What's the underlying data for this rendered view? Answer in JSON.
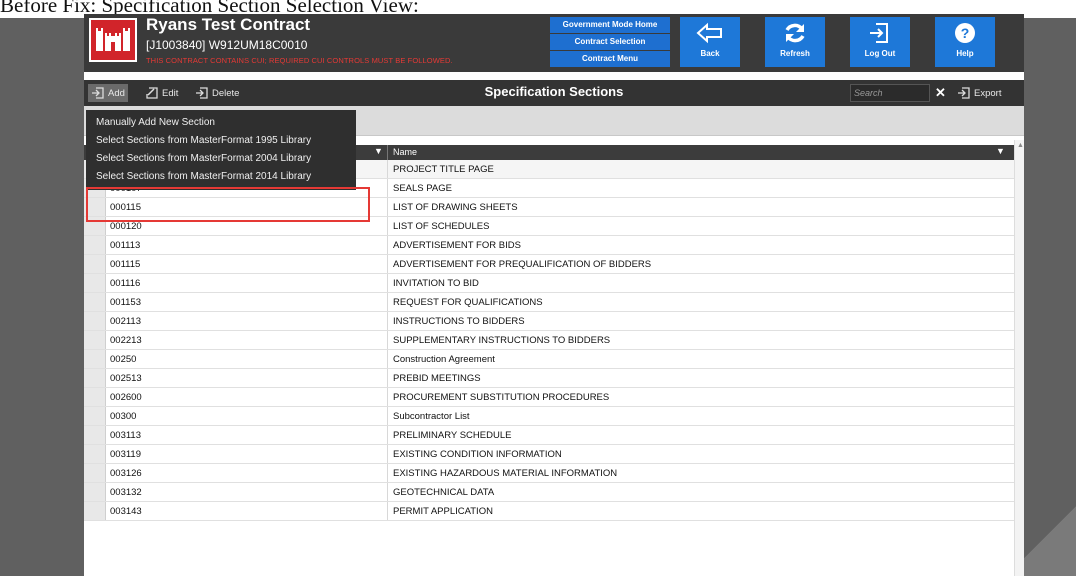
{
  "caption": "Before Fix: Specification Section Selection View:",
  "header": {
    "title": "Ryans Test Contract",
    "contract_id": "[J1003840] W912UM18C0010",
    "cui_warning": "THIS CONTRACT CONTAINS CUI; REQUIRED CUI CONTROLS MUST BE FOLLOWED.",
    "nav_links": [
      "Government Mode Home",
      "Contract Selection",
      "Contract Menu"
    ],
    "tiles": [
      {
        "label": "Back",
        "icon": "back-arrow-icon"
      },
      {
        "label": "Refresh",
        "icon": "refresh-icon"
      },
      {
        "label": "Log Out",
        "icon": "logout-icon"
      },
      {
        "label": "Help",
        "icon": "help-icon"
      }
    ],
    "colors": {
      "bar": "#3a3a3a",
      "tile": "#1e78d8",
      "link": "#1e6fd0",
      "warning": "#e53935",
      "logo": "#d1242a"
    }
  },
  "toolbar": {
    "add_label": "Add",
    "edit_label": "Edit",
    "delete_label": "Delete",
    "view_title": "Specification Sections",
    "search_placeholder": "Search",
    "clear_label": "✕",
    "export_label": "Export"
  },
  "add_menu": {
    "items": [
      "Manually Add New Section",
      "Select Sections from MasterFormat 1995 Library",
      "Select Sections from MasterFormat 2004 Library",
      "Select Sections from MasterFormat 2014 Library"
    ]
  },
  "grid": {
    "name_header": "Name",
    "rows": [
      {
        "number": "",
        "name": "PROJECT TITLE PAGE"
      },
      {
        "number": "000107",
        "name": "SEALS PAGE"
      },
      {
        "number": "000115",
        "name": "LIST OF DRAWING SHEETS"
      },
      {
        "number": "000120",
        "name": "LIST OF SCHEDULES"
      },
      {
        "number": "001113",
        "name": "ADVERTISEMENT FOR BIDS"
      },
      {
        "number": "001115",
        "name": "ADVERTISEMENT FOR PREQUALIFICATION OF BIDDERS"
      },
      {
        "number": "001116",
        "name": "INVITATION TO BID"
      },
      {
        "number": "001153",
        "name": "REQUEST FOR QUALIFICATIONS"
      },
      {
        "number": "002113",
        "name": "INSTRUCTIONS TO BIDDERS"
      },
      {
        "number": "002213",
        "name": "SUPPLEMENTARY INSTRUCTIONS TO BIDDERS"
      },
      {
        "number": "00250",
        "name": "Construction Agreement"
      },
      {
        "number": "002513",
        "name": "PREBID MEETINGS"
      },
      {
        "number": "002600",
        "name": "PROCUREMENT SUBSTITUTION PROCEDURES"
      },
      {
        "number": "00300",
        "name": "Subcontractor List"
      },
      {
        "number": "003113",
        "name": "PRELIMINARY SCHEDULE"
      },
      {
        "number": "003119",
        "name": "EXISTING CONDITION INFORMATION"
      },
      {
        "number": "003126",
        "name": "EXISTING HAZARDOUS MATERIAL INFORMATION"
      },
      {
        "number": "003132",
        "name": "GEOTECHNICAL DATA"
      },
      {
        "number": "003143",
        "name": "PERMIT APPLICATION"
      }
    ]
  }
}
